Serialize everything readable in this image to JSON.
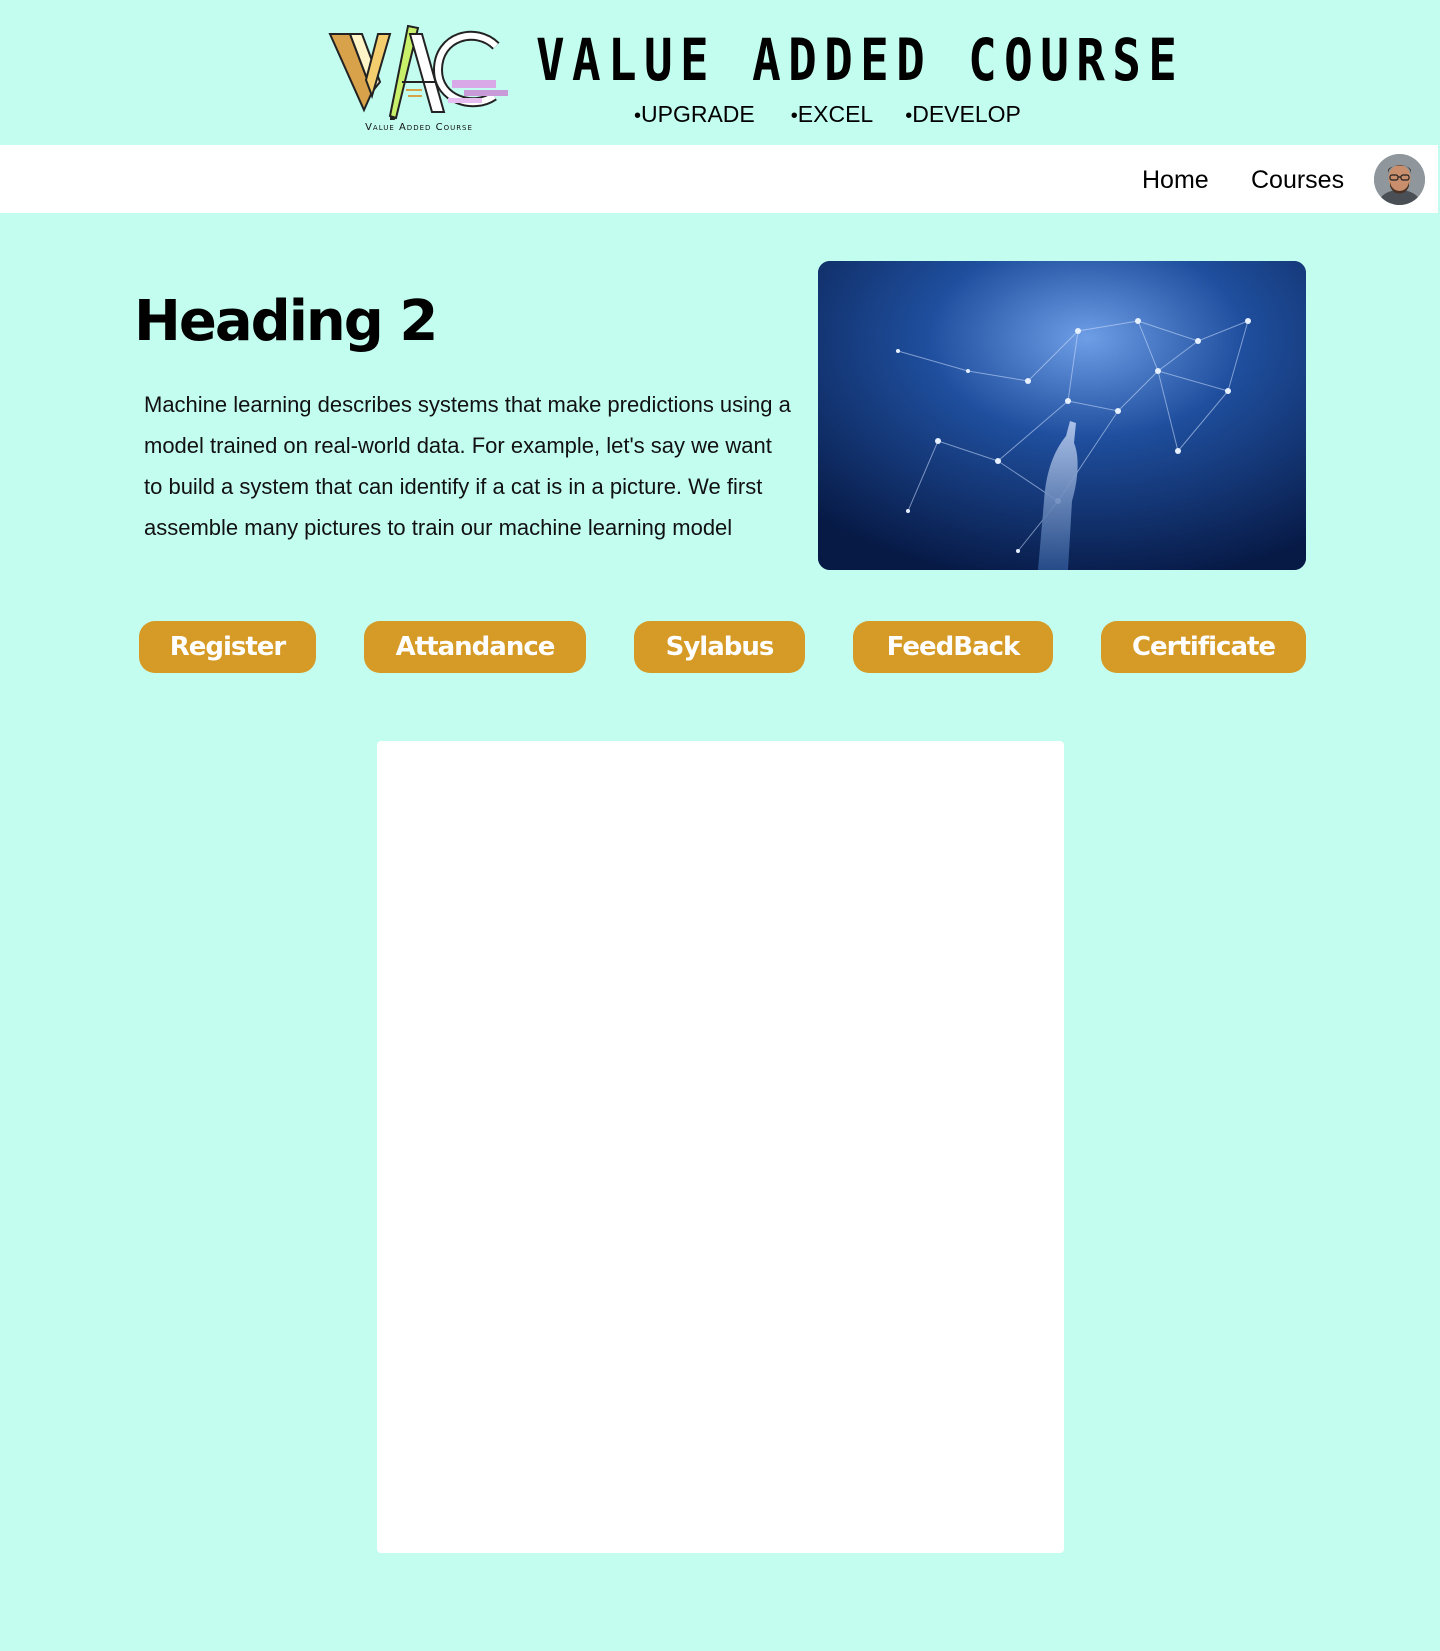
{
  "header": {
    "logo_caption": "Value Added Course",
    "logo_letters": "VAC",
    "title": "VALUE ADDED COURSE",
    "taglines": [
      {
        "bullet": "•",
        "text": "UPGRADE"
      },
      {
        "bullet": "•",
        "text": "EXCEL"
      },
      {
        "bullet": "•",
        "text": "DEVELOP"
      }
    ]
  },
  "nav": {
    "home_label": "Home",
    "courses_label": "Courses"
  },
  "hero": {
    "heading": "Heading 2",
    "description": "Machine learning describes systems that make predictions using a model trained on real-world data. For example, let's say we want to build a system that can identify if a cat is in a picture. We first assemble many pictures to train our machine learning model"
  },
  "buttons": {
    "register": "Register",
    "attendance": "Attandance",
    "syllabus": "Sylabus",
    "feedback": "FeedBack",
    "certificate": "Certificate"
  },
  "colors": {
    "page_background": "#c3fdf0",
    "nav_background": "#ffffff",
    "button_background": "#d69a26",
    "button_text": "#ffffff"
  },
  "icons": {
    "logo": "vac-logo-icon",
    "avatar": "user-avatar-icon",
    "hero_image": "ai-network-hand-image"
  }
}
